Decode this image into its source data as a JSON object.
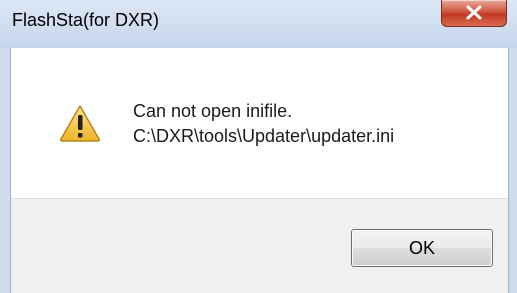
{
  "window": {
    "title": "FlashSta(for DXR)"
  },
  "dialog": {
    "icon": "warning-icon",
    "message_line1": "Can not open inifile.",
    "message_line2": "C:\\DXR\\tools\\Updater\\updater.ini"
  },
  "buttons": {
    "ok_label": "OK",
    "close_icon": "close-icon"
  },
  "colors": {
    "close_button": "#c94a30",
    "warning_fill": "#f5c33a",
    "titlebar": "#cfdcec"
  }
}
